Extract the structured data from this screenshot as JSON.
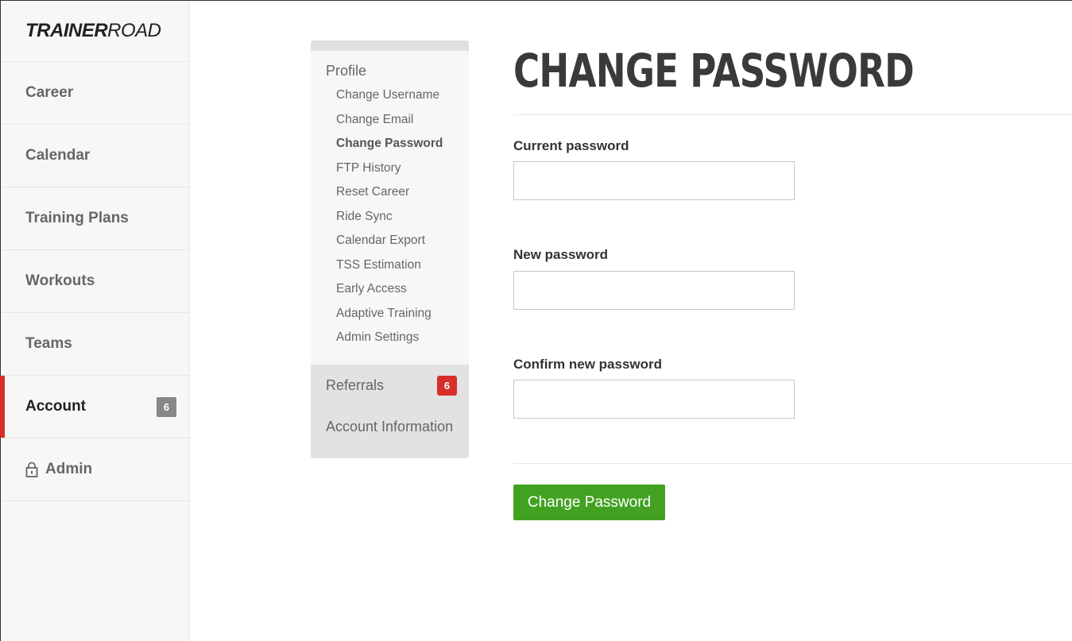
{
  "brand": {
    "logo_bold": "TRAINER",
    "logo_light": "ROAD"
  },
  "nav": {
    "items": [
      {
        "label": "Career"
      },
      {
        "label": "Calendar"
      },
      {
        "label": "Training Plans"
      },
      {
        "label": "Workouts"
      },
      {
        "label": "Teams"
      },
      {
        "label": "Account",
        "badge": "6",
        "active": true
      },
      {
        "label": "Admin",
        "icon": "lock-icon"
      }
    ]
  },
  "submenu": {
    "profile_title": "Profile",
    "links": [
      "Change Username",
      "Change Email",
      "Change Password",
      "FTP History",
      "Reset Career",
      "Ride Sync",
      "Calendar Export",
      "TSS Estimation",
      "Early Access",
      "Adaptive Training",
      "Admin Settings"
    ],
    "current_link": "Change Password",
    "referrals_label": "Referrals",
    "referrals_badge": "6",
    "account_info_label": "Account Information"
  },
  "form": {
    "title": "CHANGE PASSWORD",
    "current_label": "Current password",
    "current_value": "",
    "new_label": "New password",
    "new_value": "",
    "confirm_label": "Confirm new password",
    "confirm_value": "",
    "submit_label": "Change Password"
  },
  "colors": {
    "accent_red": "#d62f2a",
    "button_green": "#43a122",
    "badge_grey": "#888888"
  }
}
